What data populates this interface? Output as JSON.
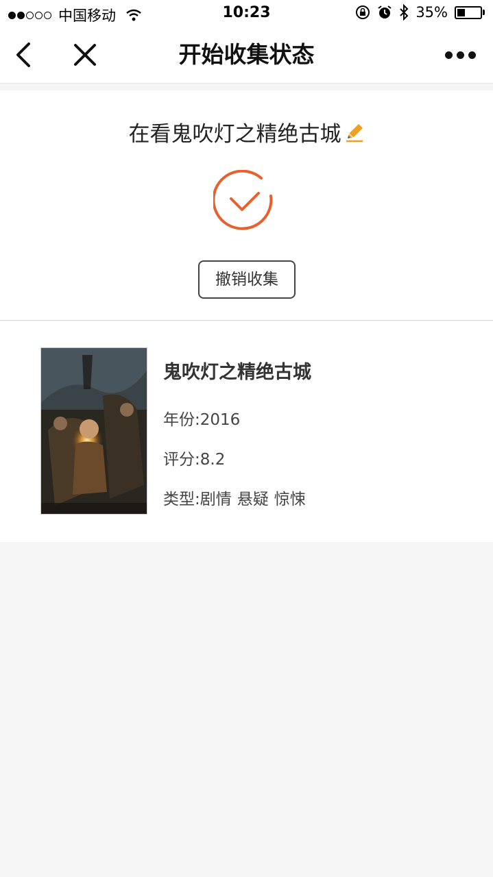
{
  "status_bar": {
    "carrier": "中国移动",
    "time": "10:23",
    "battery_percent": "35%",
    "battery_level": 0.35
  },
  "nav": {
    "title": "开始收集状态"
  },
  "status_card": {
    "title": "在看鬼吹灯之精绝古城",
    "cancel_label": "撤销收集"
  },
  "movie": {
    "title": "鬼吹灯之精绝古城",
    "year_label": "年份:",
    "year": "2016",
    "rating_label": "评分:",
    "rating": "8.2",
    "genre_label": "类型:",
    "genres": [
      "剧情",
      "悬疑",
      "惊悚"
    ]
  },
  "colors": {
    "accent": "#e8602c",
    "edit_icon": "#f0a020"
  }
}
